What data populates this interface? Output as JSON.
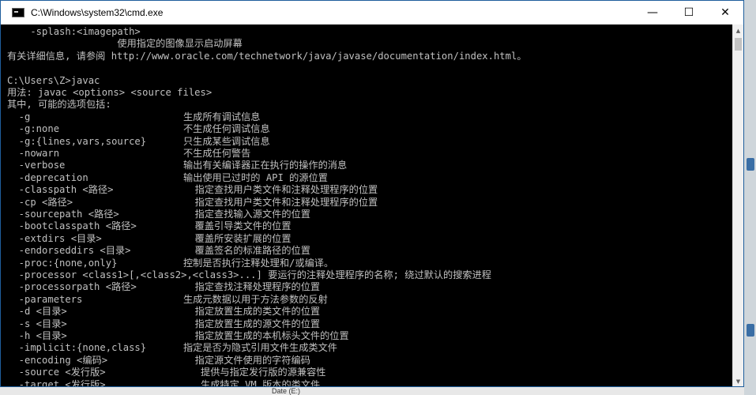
{
  "window": {
    "title": "C:\\Windows\\system32\\cmd.exe",
    "controls": {
      "minimize": "—",
      "maximize": "☐",
      "close": "✕"
    }
  },
  "console": {
    "lines": [
      {
        "a": "    -splash:<imagepath>",
        "b": ""
      },
      {
        "a": "                   使用指定的图像显示启动屏幕",
        "b": ""
      },
      {
        "a": "有关详细信息, 请参阅 http://www.oracle.com/technetwork/java/javase/documentation/index.html。",
        "b": ""
      },
      {
        "a": "",
        "b": ""
      },
      {
        "a": "C:\\Users\\Z>javac",
        "b": ""
      },
      {
        "a": "用法: javac <options> <source files>",
        "b": ""
      },
      {
        "a": "其中, 可能的选项包括:",
        "b": ""
      },
      {
        "a": "  -g",
        "b": "生成所有调试信息"
      },
      {
        "a": "  -g:none",
        "b": "不生成任何调试信息"
      },
      {
        "a": "  -g:{lines,vars,source}",
        "b": "只生成某些调试信息"
      },
      {
        "a": "  -nowarn",
        "b": "不生成任何警告"
      },
      {
        "a": "  -verbose",
        "b": "输出有关编译器正在执行的操作的消息"
      },
      {
        "a": "  -deprecation",
        "b": "输出使用已过时的 API 的源位置"
      },
      {
        "a": "  -classpath <路径>",
        "b": "  指定查找用户类文件和注释处理程序的位置"
      },
      {
        "a": "  -cp <路径>",
        "b": "  指定查找用户类文件和注释处理程序的位置"
      },
      {
        "a": "  -sourcepath <路径>",
        "b": "  指定查找输入源文件的位置"
      },
      {
        "a": "  -bootclasspath <路径>",
        "b": "  覆盖引导类文件的位置"
      },
      {
        "a": "  -extdirs <目录>",
        "b": "  覆盖所安装扩展的位置"
      },
      {
        "a": "  -endorseddirs <目录>",
        "b": "  覆盖签名的标准路径的位置"
      },
      {
        "a": "  -proc:{none,only}",
        "b": "控制是否执行注释处理和/或编译。"
      },
      {
        "a": "  -processor <class1>[,<class2>,<class3>...] 要运行的注释处理程序的名称; 绕过默认的搜索进程",
        "b": ""
      },
      {
        "a": "  -processorpath <路径>",
        "b": "  指定查找注释处理程序的位置"
      },
      {
        "a": "  -parameters",
        "b": "生成元数据以用于方法参数的反射"
      },
      {
        "a": "  -d <目录>",
        "b": "  指定放置生成的类文件的位置"
      },
      {
        "a": "  -s <目录>",
        "b": "  指定放置生成的源文件的位置"
      },
      {
        "a": "  -h <目录>",
        "b": "  指定放置生成的本机标头文件的位置"
      },
      {
        "a": "  -implicit:{none,class}",
        "b": "指定是否为隐式引用文件生成类文件"
      },
      {
        "a": "  -encoding <编码>",
        "b": "  指定源文件使用的字符编码"
      },
      {
        "a": "  -source <发行版>",
        "b": "   提供与指定发行版的源兼容性"
      },
      {
        "a": "  -target <发行版>",
        "b": "   生成特定 VM 版本的类文件"
      }
    ]
  },
  "taskbar": {
    "peek_text": "Date (E:)"
  },
  "colors": {
    "console_bg": "#000000",
    "console_text": "#c0c0c0",
    "titlebar_bg": "#ffffff"
  }
}
